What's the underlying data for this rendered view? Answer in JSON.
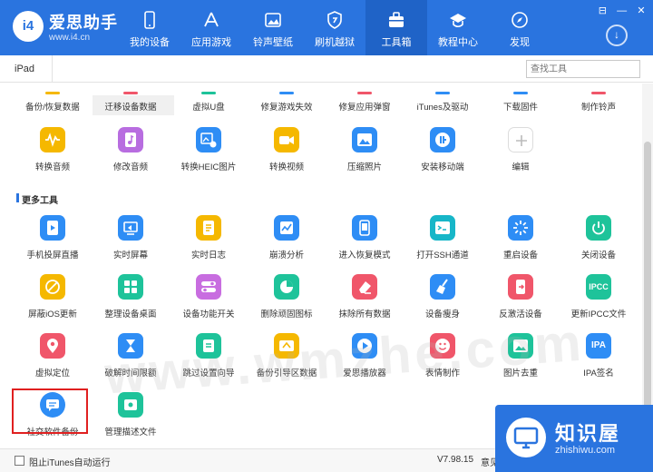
{
  "app": {
    "logo_badge": "i4",
    "logo_name": "爱思助手",
    "logo_url": "www.i4.cn"
  },
  "nav": {
    "items": [
      {
        "label": "我的设备",
        "icon": "phone-icon"
      },
      {
        "label": "应用游戏",
        "icon": "apps-icon"
      },
      {
        "label": "铃声壁纸",
        "icon": "wallpaper-icon"
      },
      {
        "label": "刷机越狱",
        "icon": "jailbreak-icon"
      },
      {
        "label": "工具箱",
        "icon": "toolbox-icon",
        "active": true
      },
      {
        "label": "教程中心",
        "icon": "graduation-icon"
      },
      {
        "label": "发现",
        "icon": "compass-icon"
      }
    ],
    "download_icon": "download-icon"
  },
  "window_buttons": {
    "menu": "⊟",
    "min": "—",
    "close": "✕"
  },
  "device_tab": "iPad",
  "search": {
    "placeholder": "查找工具"
  },
  "top_row_partial": [
    "备份/恢复数据",
    "迁移设备数据",
    "虚拟U盘",
    "修复游戏失效",
    "修复应用弹窗",
    "iTunes及驱动",
    "下载固件",
    "制作铃声"
  ],
  "row1": [
    {
      "label": "转换音频",
      "color": "#f5b800",
      "icon": "audio-wave-icon"
    },
    {
      "label": "修改音频",
      "color": "#b86de0",
      "icon": "music-file-icon"
    },
    {
      "label": "转换HEIC图片",
      "color": "#2e8df5",
      "icon": "image-convert-icon"
    },
    {
      "label": "转换视频",
      "color": "#f5b800",
      "icon": "video-camera-icon"
    },
    {
      "label": "压缩照片",
      "color": "#2e8df5",
      "icon": "photo-compress-icon"
    },
    {
      "label": "安装移动端",
      "color": "#2e8df5",
      "icon": "i4-app-icon"
    },
    {
      "label": "编辑",
      "color": "#ffffff",
      "icon": "add-icon"
    }
  ],
  "section_title": "更多工具",
  "more_tools": [
    {
      "label": "手机投屏直播",
      "color": "#2e8df5",
      "icon": "screen-cast-icon"
    },
    {
      "label": "实时屏幕",
      "color": "#2e8df5",
      "icon": "live-screen-icon"
    },
    {
      "label": "实时日志",
      "color": "#f5b800",
      "icon": "log-icon"
    },
    {
      "label": "崩溃分析",
      "color": "#2e8df5",
      "icon": "crash-analysis-icon"
    },
    {
      "label": "进入恢复模式",
      "color": "#2e8df5",
      "icon": "recovery-mode-icon"
    },
    {
      "label": "打开SSH通道",
      "color": "#17b6c8",
      "icon": "terminal-icon"
    },
    {
      "label": "重启设备",
      "color": "#2e8df5",
      "icon": "restart-icon"
    },
    {
      "label": "关闭设备",
      "color": "#1ec39a",
      "icon": "power-icon"
    },
    {
      "label": "屏蔽iOS更新",
      "color": "#f5b800",
      "icon": "block-update-icon"
    },
    {
      "label": "整理设备桌面",
      "color": "#1ec39a",
      "icon": "desktop-grid-icon"
    },
    {
      "label": "设备功能开关",
      "color": "#c86de0",
      "icon": "toggle-icon"
    },
    {
      "label": "删除顽固图标",
      "color": "#1ec39a",
      "icon": "delete-icon"
    },
    {
      "label": "抹除所有数据",
      "color": "#f0566a",
      "icon": "eraser-icon"
    },
    {
      "label": "设备瘦身",
      "color": "#2e8df5",
      "icon": "broom-icon"
    },
    {
      "label": "反激活设备",
      "color": "#f0566a",
      "icon": "deactivate-icon"
    },
    {
      "label": "更新IPCC文件",
      "color": "#1ec39a",
      "icon": "ipcc-icon",
      "text": "IPCC"
    },
    {
      "label": "虚拟定位",
      "color": "#f0566a",
      "icon": "location-pin-icon"
    },
    {
      "label": "破解时间限额",
      "color": "#2e8df5",
      "icon": "hourglass-icon"
    },
    {
      "label": "跳过设置向导",
      "color": "#1ec39a",
      "icon": "setup-skip-icon"
    },
    {
      "label": "备份引导区数据",
      "color": "#f5b800",
      "icon": "backup-boot-icon"
    },
    {
      "label": "爱思播放器",
      "color": "#2e8df5",
      "icon": "play-icon"
    },
    {
      "label": "表情制作",
      "color": "#f0566a",
      "icon": "emoji-icon"
    },
    {
      "label": "图片去重",
      "color": "#1ec39a",
      "icon": "image-dedupe-icon"
    },
    {
      "label": "IPA签名",
      "color": "#2e8df5",
      "icon": "ipa-icon",
      "text": "IPA"
    },
    {
      "label": "社交软件备份",
      "color": "#2e8df5",
      "icon": "chat-backup-icon"
    },
    {
      "label": "管理描述文件",
      "color": "#1ec39a",
      "icon": "profile-icon"
    }
  ],
  "footer": {
    "itunes_label": "阻止iTunes自动运行",
    "version": "V7.98.15",
    "feedback": "意见"
  },
  "watermark": "www.wmzhe.com",
  "badge": {
    "title": "知识屋",
    "url": "zhishiwu.com"
  }
}
